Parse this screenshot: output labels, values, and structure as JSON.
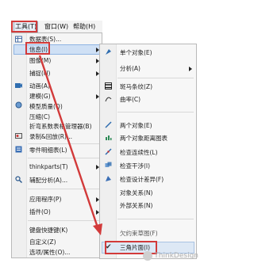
{
  "menubar": {
    "tools": "工具(T)",
    "window": "窗口(W)",
    "help": "帮助(H)"
  },
  "tools_menu": {
    "items": [
      "数据表(S)...",
      "信息(I)",
      "图像(M)",
      "捕捉(N)",
      "动画(A)",
      "建模(G)",
      "模型质量(Q)",
      "压缩(C)",
      "折弯系数表格管理器(B)",
      "录制&回放(R)...",
      "零件明细表(L)",
      "thinkparts(T)",
      "辅配分析(A)...",
      "应用程序(P)",
      "插件(O)",
      "键盘快捷键(K)",
      "自定义(Z)",
      "选项/属性(O)..."
    ]
  },
  "info_menu": {
    "items": [
      "单个对象(E)",
      "分析(A)",
      "斑马条纹(Z)",
      "曲率(C)",
      "两个对象(E)",
      "两个对象距离图表",
      "检查连续性(L)",
      "检查干涉(I)",
      "检查设计差异(F)",
      "对象关系(N)",
      "外部关系(N)",
      "欠约束草图(F)",
      "三角片面(I)"
    ],
    "checked_item": "三角片面(I)"
  },
  "watermark": "ThinkDesign",
  "colors": {
    "highlight_red": "#d23a3a",
    "hover_blue": "#cfe0f5"
  }
}
